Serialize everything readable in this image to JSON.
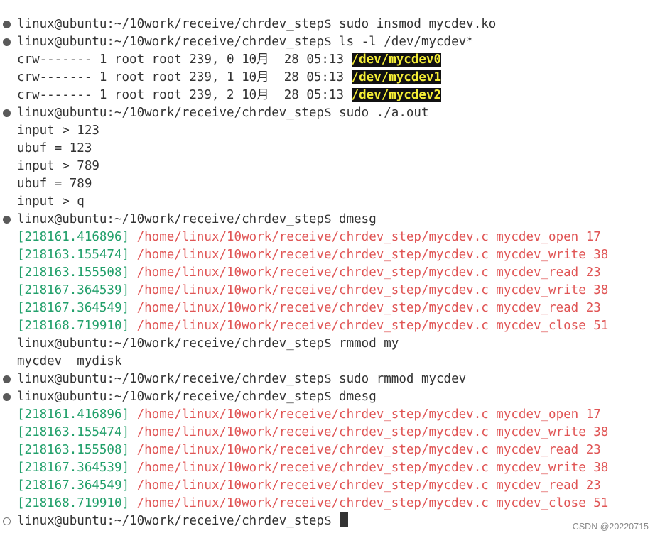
{
  "terminal": {
    "prompt": "linux@ubuntu:~/10work/receive/chrdev_step$",
    "cmd_insmod": " sudo insmod mycdev.ko",
    "cmd_ls": " ls -l /dev/mycdev*",
    "ls_rows": [
      {
        "meta": "crw------- 1 root root 239, 0 10月  28 05:13 ",
        "name": "/dev/mycdev0"
      },
      {
        "meta": "crw------- 1 root root 239, 1 10月  28 05:13 ",
        "name": "/dev/mycdev1"
      },
      {
        "meta": "crw------- 1 root root 239, 2 10月  28 05:13 ",
        "name": "/dev/mycdev2"
      }
    ],
    "cmd_aout": " sudo ./a.out",
    "aout_output": [
      "input > 123",
      "ubuf = 123",
      "input > 789",
      "ubuf = 789",
      "input > q"
    ],
    "cmd_dmesg": " dmesg",
    "dmesg_1": [
      {
        "ts": "[218161.416896]",
        "msg": " /home/linux/10work/receive/chrdev_step/mycdev.c mycdev_open 17"
      },
      {
        "ts": "[218163.155474]",
        "msg": " /home/linux/10work/receive/chrdev_step/mycdev.c mycdev_write 38"
      },
      {
        "ts": "[218163.155508]",
        "msg": " /home/linux/10work/receive/chrdev_step/mycdev.c mycdev_read 23"
      },
      {
        "ts": "[218167.364539]",
        "msg": " /home/linux/10work/receive/chrdev_step/mycdev.c mycdev_write 38"
      },
      {
        "ts": "[218167.364549]",
        "msg": " /home/linux/10work/receive/chrdev_step/mycdev.c mycdev_read 23"
      },
      {
        "ts": "[218168.719910]",
        "msg": " /home/linux/10work/receive/chrdev_step/mycdev.c mycdev_close 51"
      }
    ],
    "cmd_rmmod_partial": " rmmod my",
    "completion": "mycdev  mydisk",
    "cmd_rmmod": " sudo rmmod mycdev",
    "dmesg_2": [
      {
        "ts": "[218161.416896]",
        "msg": " /home/linux/10work/receive/chrdev_step/mycdev.c mycdev_open 17"
      },
      {
        "ts": "[218163.155474]",
        "msg": " /home/linux/10work/receive/chrdev_step/mycdev.c mycdev_write 38"
      },
      {
        "ts": "[218163.155508]",
        "msg": " /home/linux/10work/receive/chrdev_step/mycdev.c mycdev_read 23"
      },
      {
        "ts": "[218167.364539]",
        "msg": " /home/linux/10work/receive/chrdev_step/mycdev.c mycdev_write 38"
      },
      {
        "ts": "[218167.364549]",
        "msg": " /home/linux/10work/receive/chrdev_step/mycdev.c mycdev_read 23"
      },
      {
        "ts": "[218168.719910]",
        "msg": " /home/linux/10work/receive/chrdev_step/mycdev.c mycdev_close 51"
      }
    ],
    "final_cmd": " "
  },
  "watermark": "CSDN @20220715",
  "colors": {
    "timestamp": "#22a06b",
    "path": "#e05555",
    "highlight_bg": "#111111",
    "highlight_fg": "#f5ee35"
  }
}
